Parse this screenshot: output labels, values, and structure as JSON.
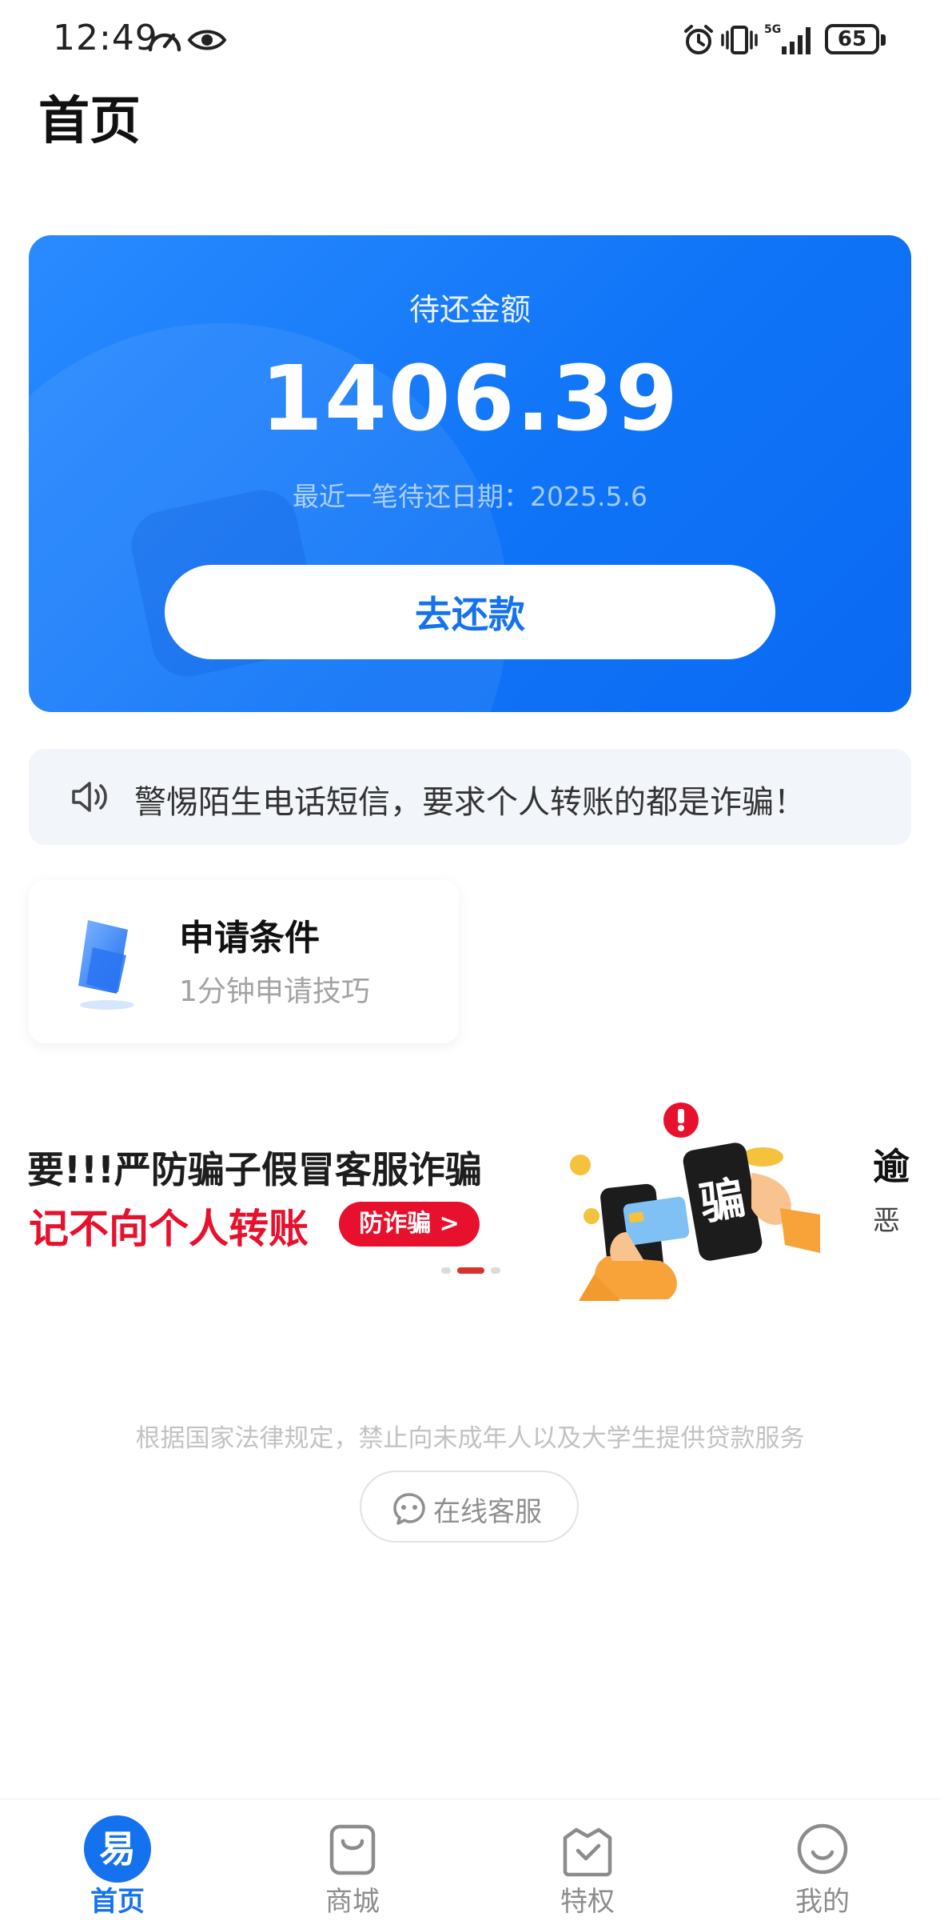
{
  "status_bar": {
    "time": "12:49",
    "network": "5G",
    "battery": "65"
  },
  "page": {
    "title": "首页"
  },
  "repay_card": {
    "label": "待还金额",
    "amount": "1406.39",
    "recent_date_label": "最近一笔待还日期：",
    "recent_date": "2025.5.6",
    "button_label": "去还款"
  },
  "notice": {
    "icon": "speaker-icon",
    "text": "警惕陌生电话短信，要求个人转账的都是诈骗！"
  },
  "apply_card": {
    "icon": "document-icon",
    "title": "申请条件",
    "subtitle": "1分钟申请技巧"
  },
  "banner": {
    "line1": "要!!!严防骗子假冒客服诈骗",
    "line2": "记不向个人转账",
    "pill_label": "防诈骗 >",
    "art_text": "骗",
    "peek_title": "逾",
    "peek_sub": "恶",
    "slide_count": 3,
    "active_slide": 2
  },
  "legal_text": "根据国家法律规定，禁止向未成年人以及大学生提供贷款服务",
  "service_button": {
    "icon": "chat-smile-icon",
    "label": "在线客服"
  },
  "bottom_nav": {
    "items": [
      {
        "label": "首页",
        "icon": "home-logo-icon",
        "active": true,
        "badge_text": "易"
      },
      {
        "label": "商城",
        "icon": "shopping-bag-icon",
        "active": false
      },
      {
        "label": "特权",
        "icon": "privilege-bag-icon",
        "active": false
      },
      {
        "label": "我的",
        "icon": "profile-smile-icon",
        "active": false
      }
    ]
  },
  "colors": {
    "brand_blue": "#1572ef",
    "warning_red": "#e8112d"
  }
}
